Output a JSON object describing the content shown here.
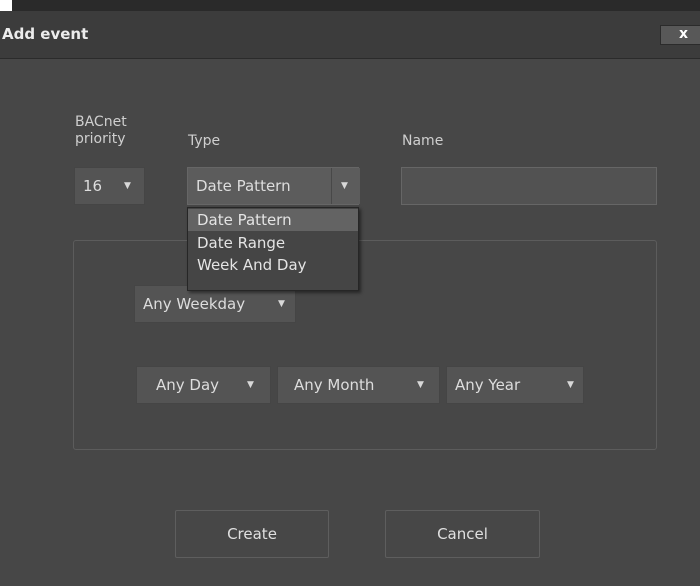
{
  "dialog": {
    "title": "Add event",
    "close_label": "x"
  },
  "fields": {
    "priority_label": "BACnet priority",
    "priority_value": "16",
    "type_label": "Type",
    "type_value": "Date Pattern",
    "name_label": "Name",
    "name_value": ""
  },
  "type_dropdown": {
    "options": [
      "Date Pattern",
      "Date Range",
      "Week And Day"
    ],
    "selected_index": 0
  },
  "pattern": {
    "weekday": "Any Weekday",
    "day": "Any Day",
    "month": "Any Month",
    "year": "Any Year"
  },
  "buttons": {
    "create": "Create",
    "cancel": "Cancel"
  },
  "icons": {
    "dropdown_arrow": "caret-down-icon",
    "close": "close-icon"
  }
}
